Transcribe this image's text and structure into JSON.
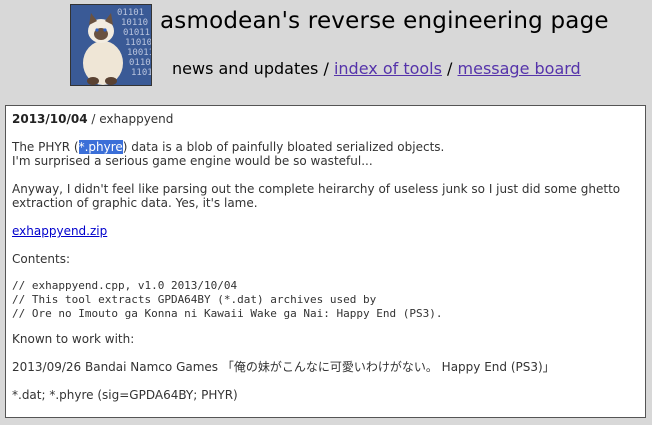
{
  "site": {
    "title": "asmodean's reverse engineering page"
  },
  "nav": {
    "current": "news and updates",
    "sep1": " / ",
    "tools": "index of tools",
    "sep2": " / ",
    "board": "message board"
  },
  "post": {
    "date": "2013/10/04",
    "separator": " / ",
    "name": "exhappyend",
    "p1_a": "The PHYR (",
    "p1_sel": "*.phyre",
    "p1_b": ") data is a blob of painfully bloated serialized objects.",
    "p1_line2": "I'm surprised a serious game engine would be so wasteful...",
    "p2_line1": "Anyway, I didn't feel like parsing out the complete heirarchy of useless junk so I just did some ghetto",
    "p2_line2": "extraction of graphic data.  Yes, it's lame.",
    "download": "exhappyend.zip",
    "contents_label": "Contents:",
    "code": [
      "// exhappyend.cpp, v1.0 2013/10/04",
      "// This tool extracts GPDA64BY (*.dat) archives used by",
      "// Ore no Imouto ga Konna ni Kawaii Wake ga Nai: Happy End (PS3)."
    ],
    "known_label": "Known to work with:",
    "game_line": "2013/09/26   Bandai Namco Games    「俺の妹がこんなに可愛いわけがない。 Happy End (PS3)」",
    "formats": "*.dat; *.phyre (sig=GPDA64BY; PHYR)"
  }
}
